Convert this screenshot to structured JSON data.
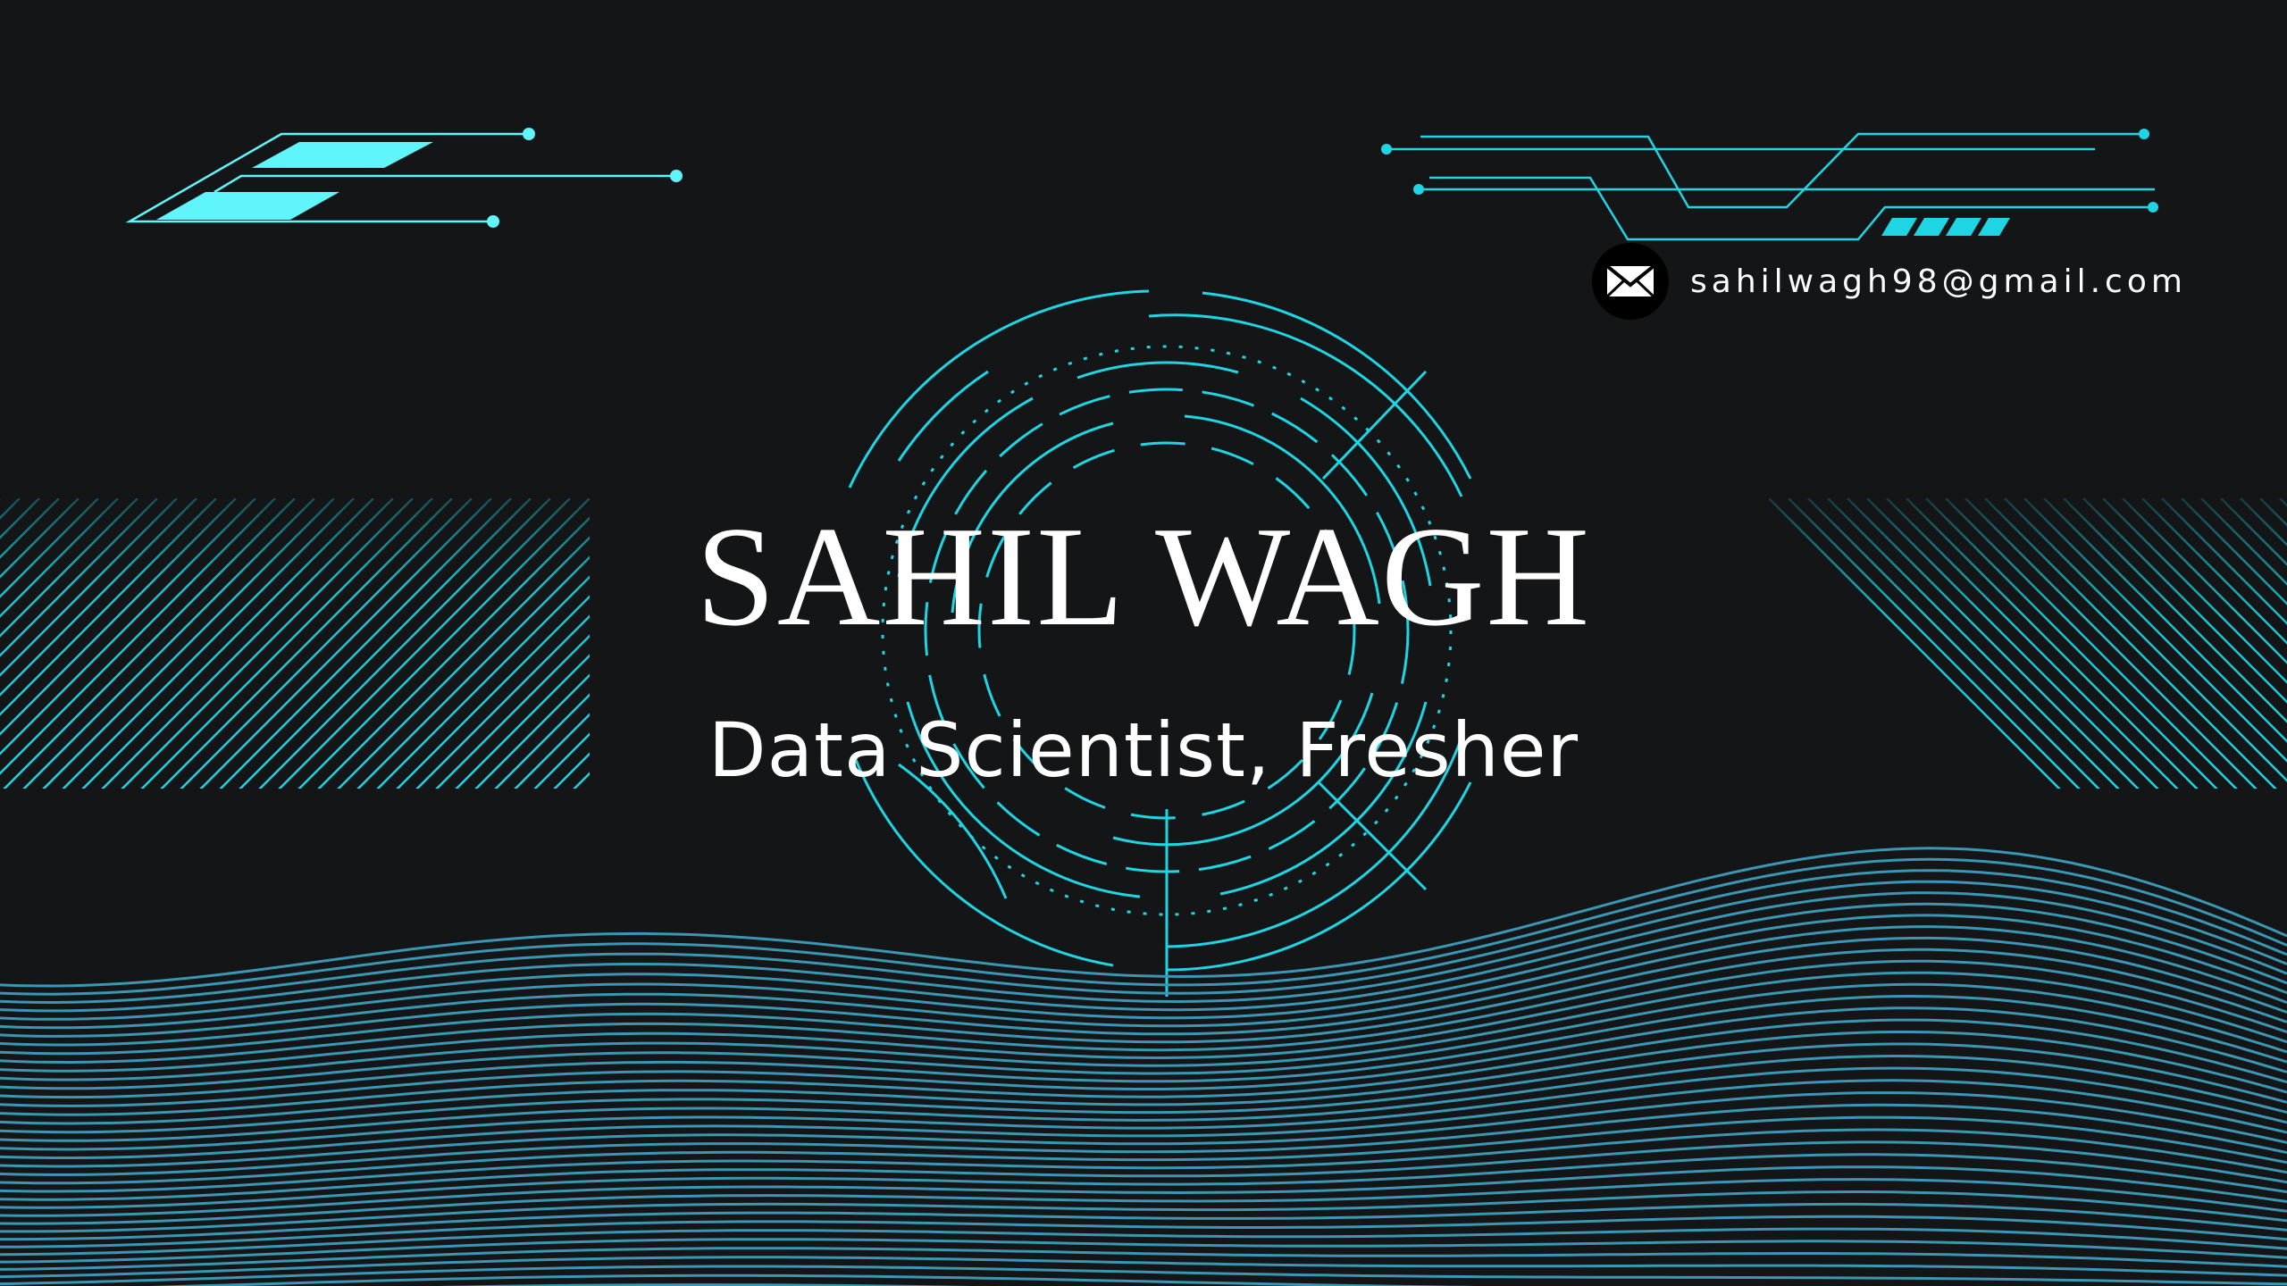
{
  "card": {
    "name": "SAHIL WAGH",
    "title": "Data Scientist, Fresher",
    "email": "sahilwagh98@gmail.com",
    "email_icon": "envelope-icon"
  },
  "colors": {
    "background": "#131517",
    "accent_cyan": "#1fd5e3",
    "accent_fill": "#5ff5fa",
    "wave": "#3a96b3",
    "text": "#ffffff"
  },
  "decorations": {
    "top_left": "circuit-lines",
    "top_right": "circuit-lines",
    "center": "radar-rings",
    "left_right_bands": "diagonal-hatching",
    "bottom": "wave-lines"
  }
}
